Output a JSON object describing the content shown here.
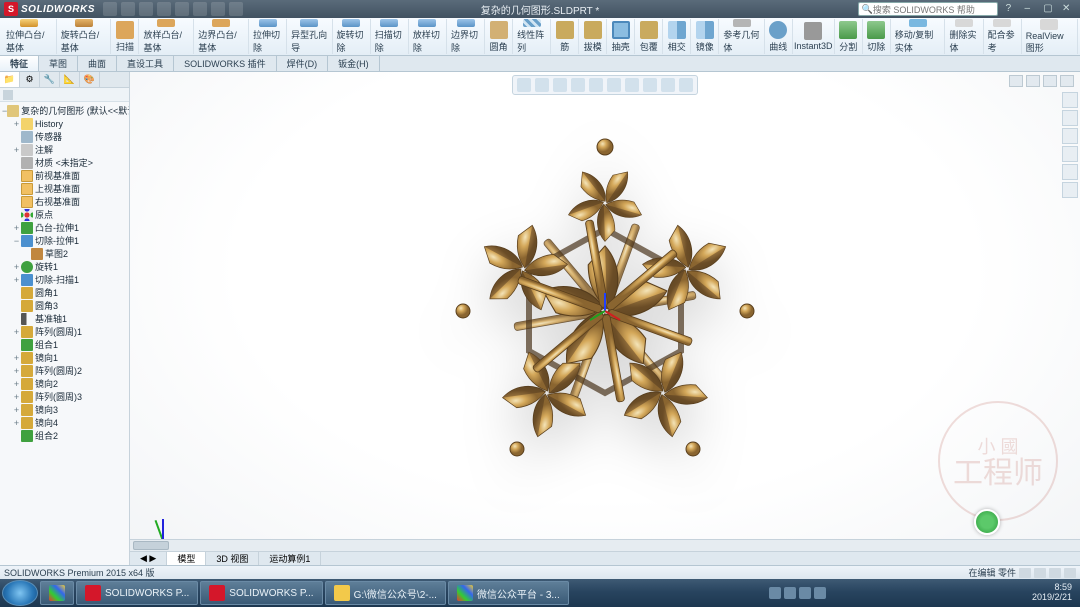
{
  "title_bar": {
    "brand": "SOLIDWORKS",
    "doc_title": "复杂的几何图形.SLDPRT *",
    "search_placeholder": "搜索 SOLIDWORKS 帮助"
  },
  "ribbon": [
    {
      "label": "拉伸凸台/基体",
      "cls": "i-extrude"
    },
    {
      "label": "旋转凸台/基体",
      "cls": "i-revolve"
    },
    {
      "label": "扫描",
      "cls": "i-sweep"
    },
    {
      "label": "放样凸台/基体",
      "cls": "i-sweep"
    },
    {
      "label": "边界凸台/基体",
      "cls": "i-sweep"
    },
    {
      "label": "拉伸切除",
      "cls": "i-cut"
    },
    {
      "label": "异型孔向导",
      "cls": "i-cut"
    },
    {
      "label": "旋转切除",
      "cls": "i-cut"
    },
    {
      "label": "扫描切除",
      "cls": "i-cut"
    },
    {
      "label": "放样切除",
      "cls": "i-cut"
    },
    {
      "label": "边界切除",
      "cls": "i-cut"
    },
    {
      "label": "圆角",
      "cls": "i-fillet"
    },
    {
      "label": "线性阵列",
      "cls": "i-pattern"
    },
    {
      "label": "筋",
      "cls": "i-rib"
    },
    {
      "label": "拔模",
      "cls": "i-rib"
    },
    {
      "label": "抽壳",
      "cls": "i-shell"
    },
    {
      "label": "包覆",
      "cls": "i-rib"
    },
    {
      "label": "相交",
      "cls": "i-mirror"
    },
    {
      "label": "镜像",
      "cls": "i-mirror"
    },
    {
      "label": "参考几何体",
      "cls": "i-geom"
    },
    {
      "label": "曲线",
      "cls": "i-curve"
    },
    {
      "label": "Instant3D",
      "cls": "i-instant"
    },
    {
      "label": "分割",
      "cls": "i-split"
    },
    {
      "label": "切除",
      "cls": "i-split"
    },
    {
      "label": "移动/复制实体",
      "cls": "i-move"
    },
    {
      "label": "删除实体",
      "cls": "i-plain"
    },
    {
      "label": "配合参考",
      "cls": "i-plain"
    },
    {
      "label": "RealView 图形",
      "cls": "i-plain"
    }
  ],
  "tabs": [
    "特征",
    "草图",
    "曲面",
    "直设工具",
    "SOLIDWORKS 插件",
    "焊件(D)",
    "钣金(H)"
  ],
  "active_tab": 0,
  "tree": {
    "root": "复杂的几何图形  (默认<<默认...",
    "items": [
      {
        "label": "History",
        "icon": "folder",
        "depth": 1,
        "toggle": "+"
      },
      {
        "label": "传感器",
        "icon": "sensor",
        "depth": 1,
        "toggle": ""
      },
      {
        "label": "注解",
        "icon": "anno",
        "depth": 1,
        "toggle": "+"
      },
      {
        "label": "材质 <未指定>",
        "icon": "mat",
        "depth": 1,
        "toggle": ""
      },
      {
        "label": "前视基准面",
        "icon": "plane",
        "depth": 1,
        "toggle": ""
      },
      {
        "label": "上视基准面",
        "icon": "plane",
        "depth": 1,
        "toggle": ""
      },
      {
        "label": "右视基准面",
        "icon": "plane",
        "depth": 1,
        "toggle": ""
      },
      {
        "label": "原点",
        "icon": "origin",
        "depth": 1,
        "toggle": ""
      },
      {
        "label": "凸台-拉伸1",
        "icon": "feat-add",
        "depth": 1,
        "toggle": "+"
      },
      {
        "label": "切除-拉伸1",
        "icon": "feat-cut",
        "depth": 1,
        "toggle": "−"
      },
      {
        "label": "草图2",
        "icon": "sketch",
        "depth": 2,
        "toggle": ""
      },
      {
        "label": "旋转1",
        "icon": "feat-rev",
        "depth": 1,
        "toggle": "+"
      },
      {
        "label": "切除-扫描1",
        "icon": "feat-cut",
        "depth": 1,
        "toggle": "+"
      },
      {
        "label": "圆角1",
        "icon": "feat-goldpat",
        "depth": 1,
        "toggle": ""
      },
      {
        "label": "圆角3",
        "icon": "feat-goldpat",
        "depth": 1,
        "toggle": ""
      },
      {
        "label": "基准轴1",
        "icon": "axis",
        "depth": 1,
        "toggle": ""
      },
      {
        "label": "阵列(圆周)1",
        "icon": "feat-goldpat",
        "depth": 1,
        "toggle": "+"
      },
      {
        "label": "组合1",
        "icon": "feat-add",
        "depth": 1,
        "toggle": ""
      },
      {
        "label": "镜向1",
        "icon": "feat-goldpat",
        "depth": 1,
        "toggle": "+"
      },
      {
        "label": "阵列(圆周)2",
        "icon": "feat-goldpat",
        "depth": 1,
        "toggle": "+"
      },
      {
        "label": "镜向2",
        "icon": "feat-goldpat",
        "depth": 1,
        "toggle": "+"
      },
      {
        "label": "阵列(圆周)3",
        "icon": "feat-goldpat",
        "depth": 1,
        "toggle": "+"
      },
      {
        "label": "镜向3",
        "icon": "feat-goldpat",
        "depth": 1,
        "toggle": "+"
      },
      {
        "label": "镜向4",
        "icon": "feat-goldpat",
        "depth": 1,
        "toggle": "+"
      },
      {
        "label": "组合2",
        "icon": "feat-add",
        "depth": 1,
        "toggle": ""
      }
    ]
  },
  "view_tabs": [
    "模型",
    "3D 视图",
    "运动算例1"
  ],
  "active_view_tab": 0,
  "status": {
    "left": "SOLIDWORKS Premium 2015 x64 版",
    "right": "在编辑  零件"
  },
  "watermark": {
    "line1": "小 國",
    "line2": "工程师"
  },
  "taskbar": {
    "items": [
      {
        "label": "",
        "icon": "app"
      },
      {
        "label": "SOLIDWORKS P...",
        "icon": "sw"
      },
      {
        "label": "SOLIDWORKS P...",
        "icon": "sw"
      },
      {
        "label": "G:\\微信公众号\\2-...",
        "icon": "exp"
      },
      {
        "label": "微信公众平台 - 3...",
        "icon": "app"
      }
    ],
    "time": "8:59",
    "date": "2019/2/21"
  }
}
